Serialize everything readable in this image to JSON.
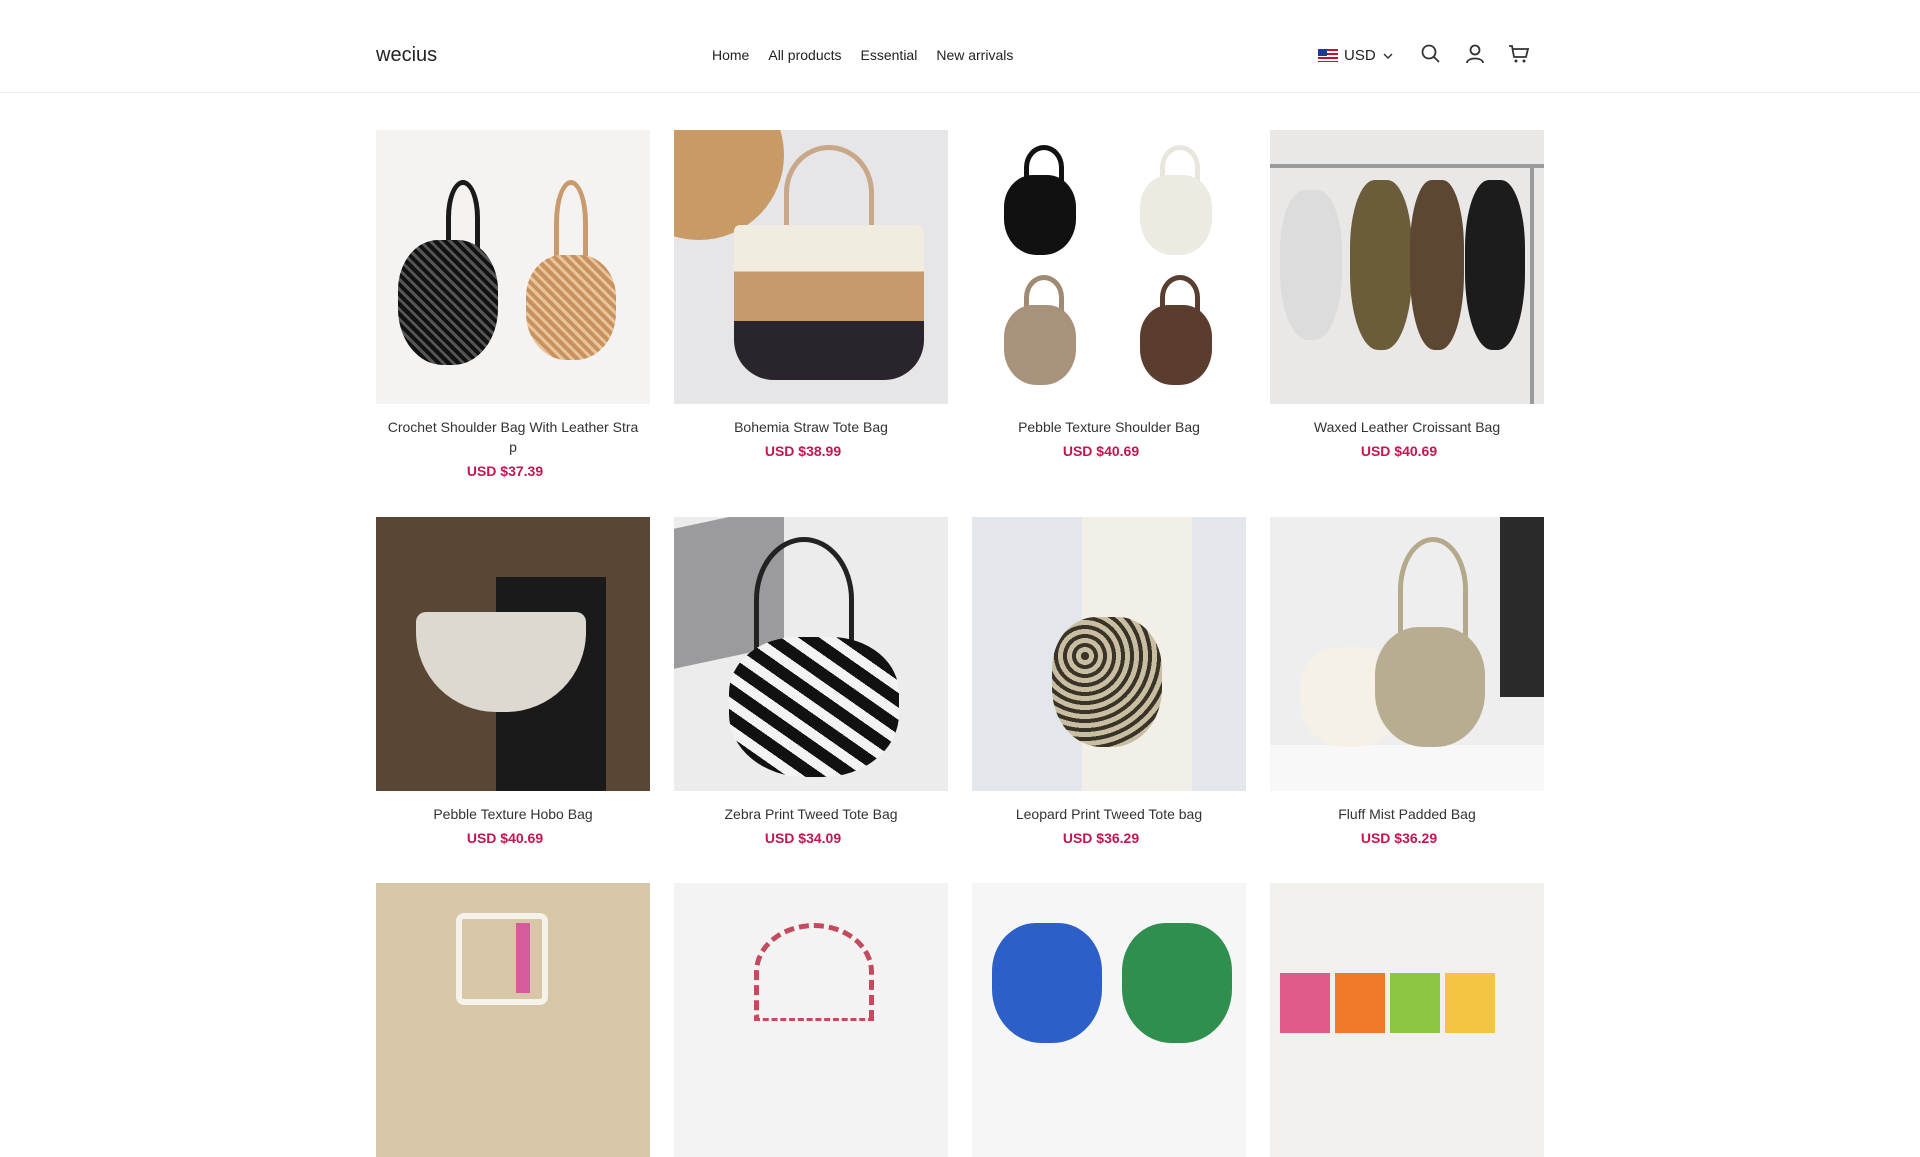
{
  "header": {
    "logo": "wecius",
    "nav": [
      "Home",
      "All products",
      "Essential",
      "New arrivals"
    ],
    "currency": "USD",
    "icons": [
      "search-icon",
      "account-icon",
      "cart-icon"
    ]
  },
  "products": [
    {
      "title": "Crochet Shoulder Bag With Leather Stra p",
      "price": "USD $37.39"
    },
    {
      "title": "Bohemia Straw Tote Bag",
      "price": "USD $38.99"
    },
    {
      "title": "Pebble Texture Shoulder Bag",
      "price": "USD $40.69"
    },
    {
      "title": "Waxed Leather Croissant Bag",
      "price": "USD $40.69"
    },
    {
      "title": "Pebble Texture Hobo Bag",
      "price": "USD $40.69"
    },
    {
      "title": "Zebra Print Tweed Tote Bag",
      "price": "USD $34.09"
    },
    {
      "title": "Leopard Print Tweed Tote bag",
      "price": "USD $36.29"
    },
    {
      "title": "Fluff Mist Padded Bag",
      "price": "USD $36.29"
    }
  ],
  "colors": {
    "price": "#c4154f",
    "text": "#222222",
    "border": "#ececec"
  }
}
